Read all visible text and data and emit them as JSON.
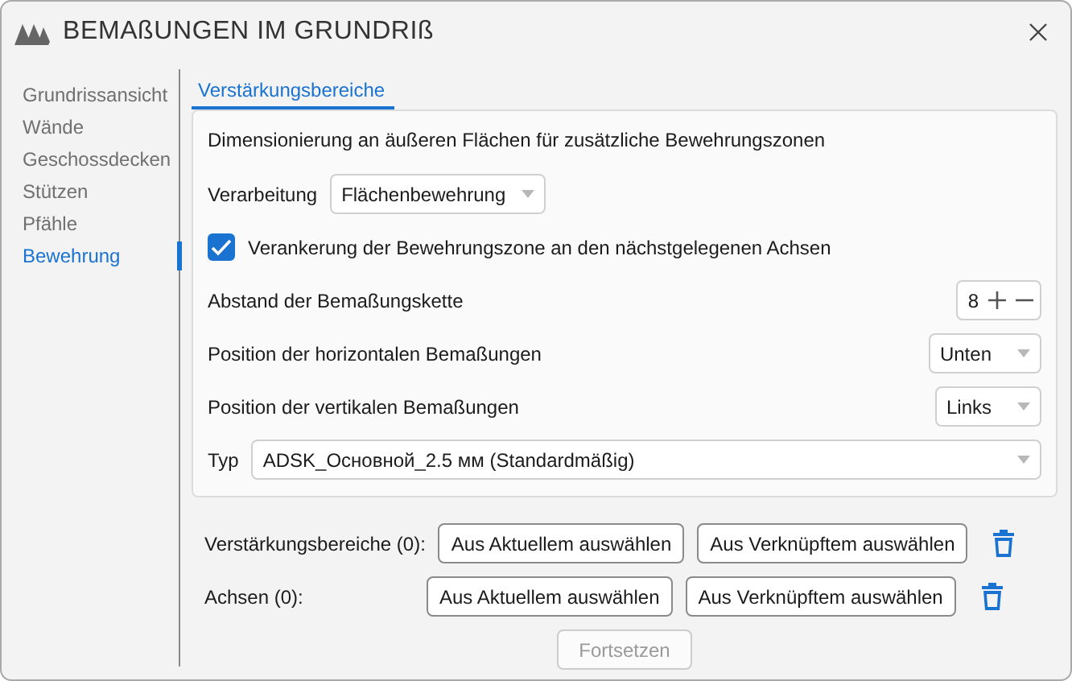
{
  "window": {
    "title": "BEMAßUNGEN IM GRUNDRIß"
  },
  "sidebar": {
    "items": [
      {
        "label": "Grundrissansicht",
        "selected": false
      },
      {
        "label": "Wände",
        "selected": false
      },
      {
        "label": "Geschossdecken",
        "selected": false
      },
      {
        "label": "Stützen",
        "selected": false
      },
      {
        "label": "Pfähle",
        "selected": false
      },
      {
        "label": "Bewehrung",
        "selected": true
      }
    ]
  },
  "tabs": [
    {
      "label": "Verstärkungsbereiche",
      "selected": true
    }
  ],
  "panel": {
    "description": "Dimensionierung an äußeren Flächen für zusätzliche Bewehrungszonen",
    "rows": [
      {
        "kind": "dropdown",
        "label": "Verarbeitung",
        "value": "Flächenbewehrung"
      },
      {
        "kind": "checkbox",
        "label": "Verankerung der Bewehrungszone an den nächstgelegenen Achsen",
        "checked": true
      },
      {
        "kind": "stepper",
        "label": "Abstand der Bemaßungskette",
        "value": "8"
      },
      {
        "kind": "dropdown-end",
        "label": "Position der horizontalen Bemaßungen",
        "value": "Unten"
      },
      {
        "kind": "dropdown-end",
        "label": "Position der vertikalen Bemaßungen",
        "value": "Links"
      },
      {
        "kind": "dropdown-wide",
        "label": "Typ",
        "value": "ADSK_Основной_2.5 мм (Standardmäßig)"
      }
    ]
  },
  "selections": [
    {
      "label": "Verstärkungsbereiche (0):",
      "buttons": [
        "Aus Aktuellem auswählen",
        "Aus Verknüpftem auswählen"
      ]
    },
    {
      "label": "Achsen (0):",
      "buttons": [
        "Aus Aktuellem auswählen",
        "Aus Verknüpftem auswählen"
      ]
    }
  ],
  "continue_button": {
    "label": "Fortsetzen",
    "disabled": true
  }
}
